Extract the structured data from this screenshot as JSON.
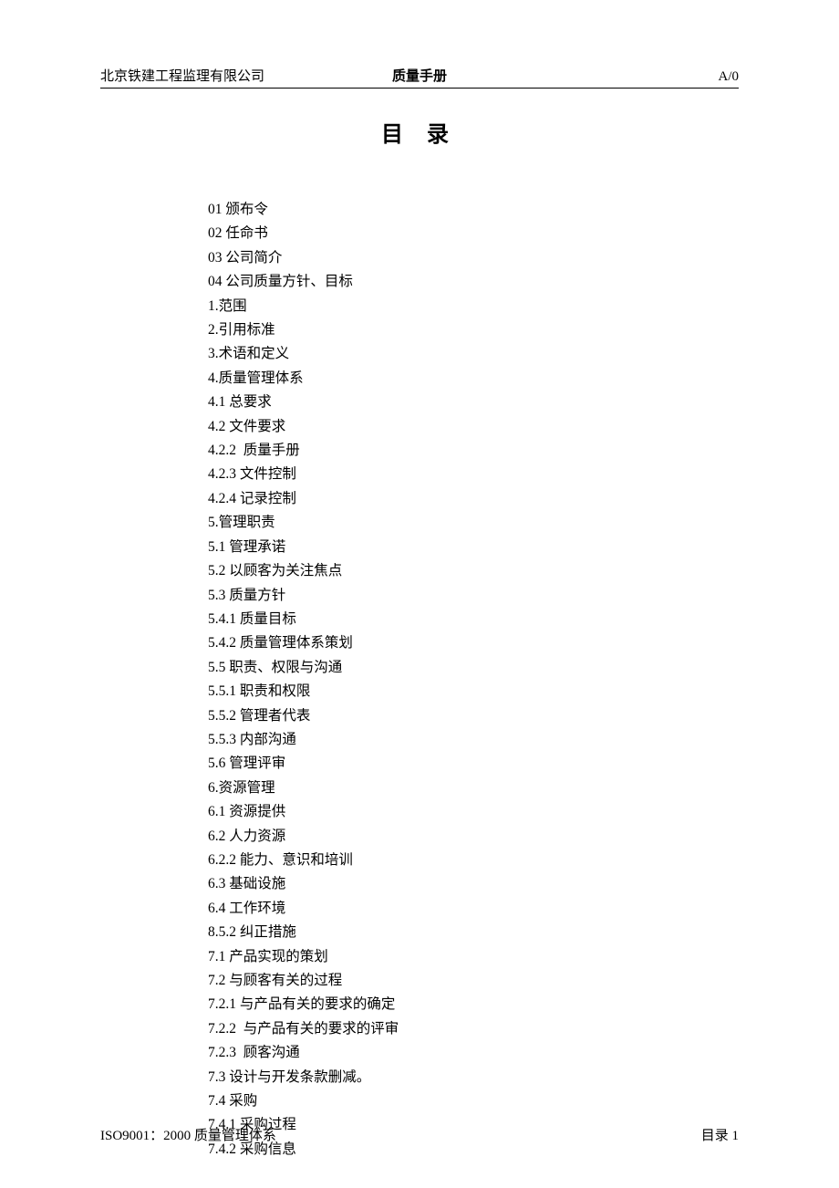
{
  "header": {
    "left": "北京铁建工程监理有限公司",
    "center": "质量手册",
    "right": "A/0"
  },
  "title": "目 录",
  "toc": [
    "01 颁布令",
    "02 任命书",
    "03 公司简介",
    "04 公司质量方针、目标",
    "1.范围",
    "2.引用标准",
    "3.术语和定义",
    "4.质量管理体系",
    "4.1 总要求",
    "4.2 文件要求",
    "4.2.2  质量手册",
    "4.2.3 文件控制",
    "4.2.4 记录控制",
    "5.管理职责",
    "5.1 管理承诺",
    "5.2 以顾客为关注焦点",
    "5.3 质量方针",
    "5.4.1 质量目标",
    "5.4.2 质量管理体系策划",
    "5.5 职责、权限与沟通",
    "5.5.1 职责和权限",
    "5.5.2 管理者代表",
    "5.5.3 内部沟通",
    "5.6 管理评审",
    "6.资源管理",
    "6.1 资源提供",
    "6.2 人力资源",
    "6.2.2 能力、意识和培训",
    "6.3 基础设施",
    "6.4 工作环境",
    "8.5.2 纠正措施",
    "7.1 产品实现的策划",
    "7.2 与顾客有关的过程",
    "7.2.1 与产品有关的要求的确定",
    "7.2.2  与产品有关的要求的评审",
    "7.2.3  顾客沟通",
    "7.3 设计与开发条款删减。",
    "7.4 采购",
    "7.4.1 采购过程",
    "7.4.2 采购信息"
  ],
  "footer": {
    "left": "ISO9001：2000 质量管理体系",
    "right": "目录 1"
  }
}
